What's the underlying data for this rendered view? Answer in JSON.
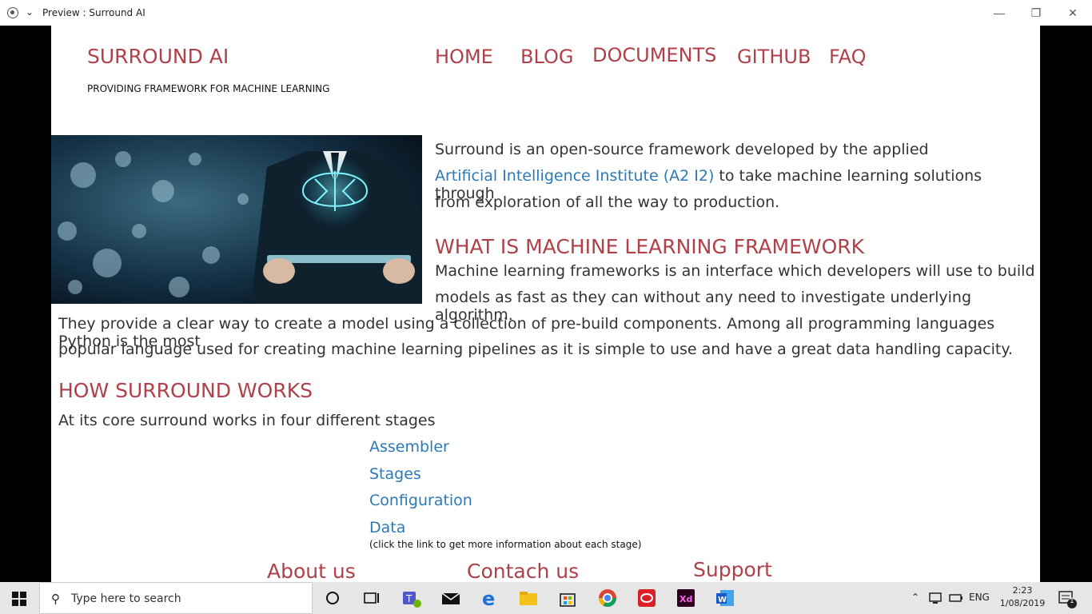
{
  "window": {
    "title": "Preview : Surround AI"
  },
  "header": {
    "brand": "SURROUND AI",
    "tagline": "PROVIDING FRAMEWORK FOR MACHINE LEARNING",
    "nav": [
      "HOME",
      "BLOG",
      "DOCUMENTS",
      "GITHUB",
      "FAQ"
    ]
  },
  "intro": {
    "line1": "Surround is an open-source framework developed by the applied",
    "link": "Artificial Intelligence Institute (A2 I2)",
    "line2_rest": " to take machine learning solutions through",
    "line3": "from exploration of all the way to production."
  },
  "what": {
    "heading": "WHAT IS MACHINE LEARNING FRAMEWORK",
    "line1": "Machine learning frameworks is an interface which developers will use to build",
    "line2": "models as fast as they can without any need to investigate underlying algorithm.",
    "line3": "They provide a clear way to create a model using a collection of pre-build components. Among all programming languages Python is the most",
    "line4": "popular language used for creating machine learning  pipelines as it is simple to use and have a great data handling capacity."
  },
  "how": {
    "heading": "HOW SURROUND WORKS",
    "text": "At its core surround works in four different stages",
    "stages": [
      "Assembler",
      "Stages",
      "Configuration",
      "Data"
    ],
    "note": "(click the link to get more information about each stage)"
  },
  "footer": {
    "about": "About us",
    "contact": "Contach us",
    "support": "Support"
  },
  "taskbar": {
    "search_placeholder": "Type here to search",
    "lang": "ENG",
    "time": "2:23",
    "date": "1/08/2019",
    "notifications": "1"
  },
  "colors": {
    "accent": "#b0404a",
    "link": "#2b79b5",
    "text": "#333333"
  }
}
